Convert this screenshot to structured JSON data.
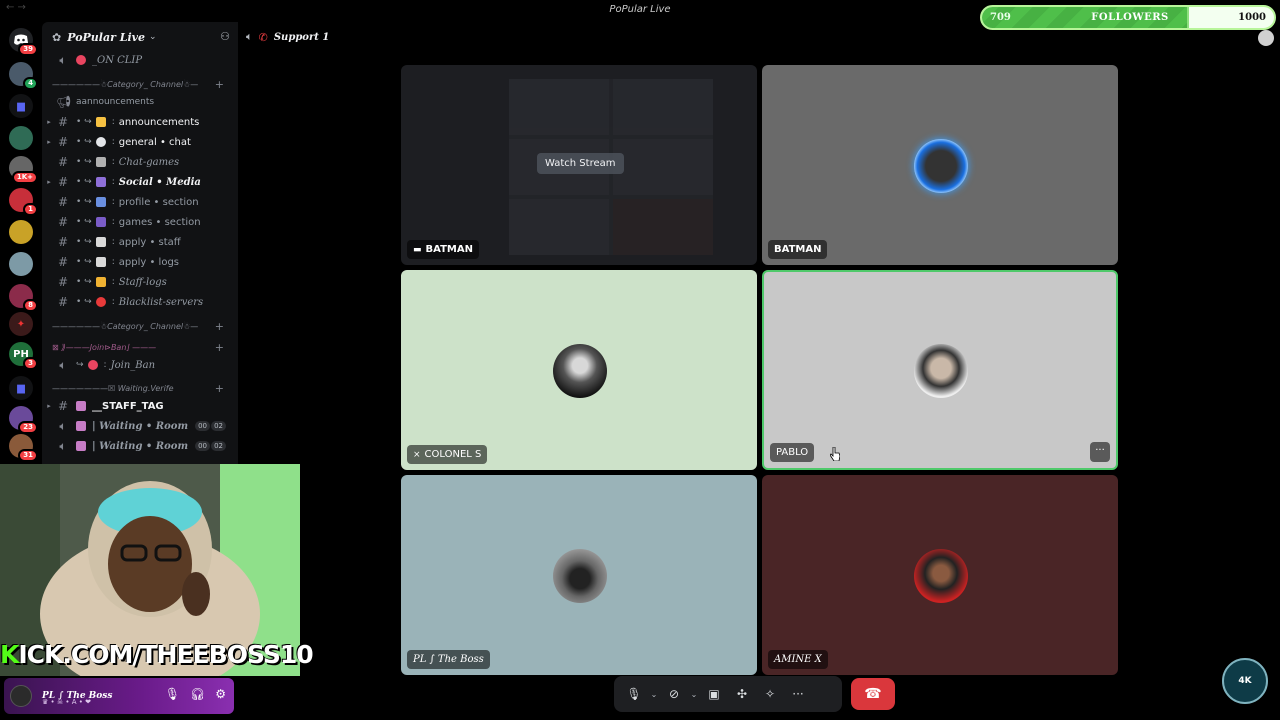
{
  "window": {
    "title": "PoPular Live"
  },
  "followers": {
    "current": "709",
    "label": "FOLLOWERS",
    "goal": "1000",
    "progress_pct": 70.9
  },
  "server": {
    "name": "PoPular Live"
  },
  "voice_channel": {
    "name": "Support 1"
  },
  "server_badges": [
    "39",
    "",
    "",
    "",
    "1K+",
    "",
    "1",
    "",
    "",
    "8",
    "",
    "3",
    "",
    "23",
    "31"
  ],
  "channels": {
    "on_clip": "_ON CLIP",
    "cat1": "——————☃Category_ Channel☃—",
    "announcements_cat": "aannouncements",
    "announcements": "announcements",
    "general": "general • chat",
    "chat_games": "Chat-games",
    "social_media": "Social • Media",
    "profile_section": "profile • section",
    "games_section": "games • section",
    "apply_staff": "apply • staff",
    "apply_logs": "apply • logs",
    "staff_logs": "Staff-logs",
    "blacklist": "Blacklist-servers",
    "cat2": "——————☃Category_ Channel☃—",
    "join_ban_cat": "⊠ ⟫———Join⊳Ban⌋ ———",
    "join_ban": "Join_Ban",
    "waiting_cat": "———————☒ Waiting.Verife",
    "staff_tag": "__STAFF_TAG",
    "waiting_room_1": "| Waiting • Room",
    "waiting_room_2": "| Waiting • Room",
    "wr_count_a": "00",
    "wr_count_b": "02"
  },
  "tiles": {
    "t1": {
      "name": "BATMAN",
      "action": "Watch Stream",
      "bg": "#1d1e22"
    },
    "t2": {
      "name": "BATMAN",
      "bg": "#6a6a6a"
    },
    "t3": {
      "name": "COLONEL S",
      "bg": "#cde2c9"
    },
    "t4": {
      "name": "PABLO",
      "bg": "#c8c8c8"
    },
    "t5": {
      "name": "PL ∫ The Boss",
      "bg": "#9ab3b8"
    },
    "t6": {
      "name": "AMINE X",
      "bg": "#4a2526"
    }
  },
  "webcam": {
    "kick_prefix": "K",
    "kick_rest": "ICK.COM/THEEBOSS10"
  },
  "user": {
    "name": "PL ∫ The Boss",
    "status": "♛ • ☠ • A • ❤"
  },
  "logo": {
    "text": "4K"
  },
  "colors": {
    "accent_green": "#53fc18",
    "hangup_red": "#da373c",
    "bg": "#000000"
  }
}
